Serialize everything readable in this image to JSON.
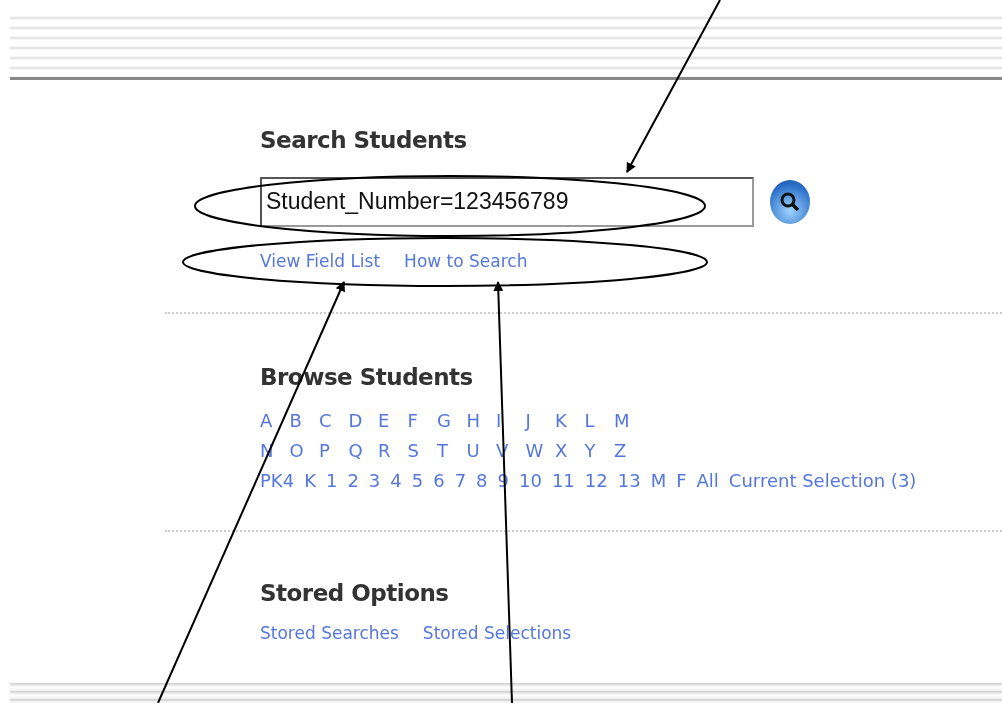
{
  "search": {
    "heading": "Search Students",
    "value": "Student_Number=123456789",
    "links": [
      "View Field List",
      "How to Search"
    ]
  },
  "browse": {
    "heading": "Browse Students",
    "letter_rows": [
      [
        "A",
        "B",
        "C",
        "D",
        "E",
        "F",
        "G",
        "H",
        "I",
        "J",
        "K",
        "L",
        "M"
      ],
      [
        "N",
        "O",
        "P",
        "Q",
        "R",
        "S",
        "T",
        "U",
        "V",
        "W",
        "X",
        "Y",
        "Z"
      ]
    ],
    "grade_links": [
      "PK4",
      "K",
      "1",
      "2",
      "3",
      "4",
      "5",
      "6",
      "7",
      "8",
      "9",
      "10",
      "11",
      "12",
      "13",
      "M",
      "F",
      "All",
      "Current Selection (3)"
    ]
  },
  "stored": {
    "heading": "Stored Options",
    "links": [
      "Stored Searches",
      "Stored Selections"
    ]
  }
}
